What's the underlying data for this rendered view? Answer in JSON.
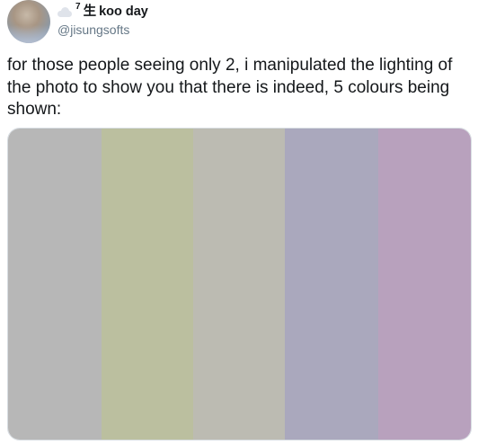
{
  "tweet": {
    "display_name": "koo day",
    "name_prefix_sup": "7",
    "name_prefix_char": "生",
    "handle": "@jisungsofts",
    "text": "for those people seeing only 2, i manipulated the lighting of the photo to show you that there is indeed, 5 colours being shown:"
  },
  "icons": {
    "avatar": "profile-photo",
    "emoji": "cloud-icon"
  },
  "media": {
    "swatches": [
      {
        "color": "#b7b7b7"
      },
      {
        "color": "#bbbf9f"
      },
      {
        "color": "#bcbbb2"
      },
      {
        "color": "#aaa8bd"
      },
      {
        "color": "#b8a1bd"
      }
    ]
  }
}
